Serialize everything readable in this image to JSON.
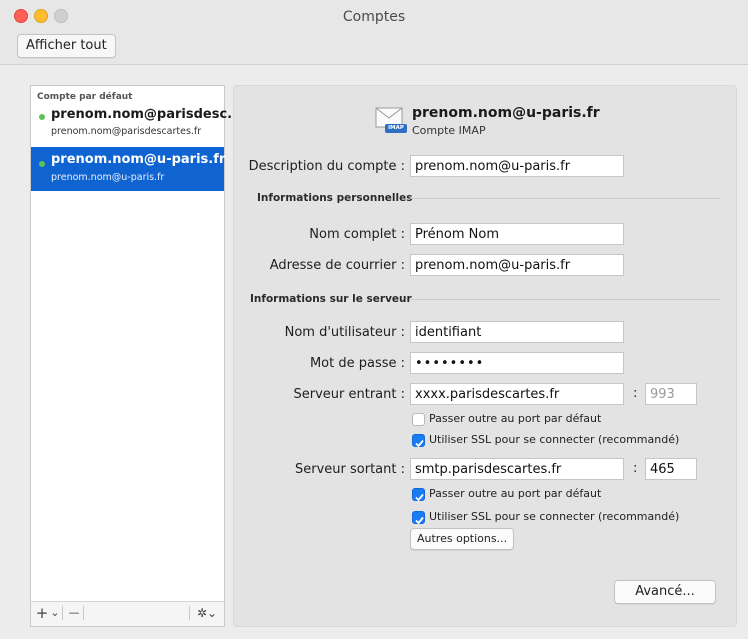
{
  "window": {
    "title": "Comptes",
    "show_all_label": "Afficher tout"
  },
  "sidebar": {
    "header": "Compte par défaut",
    "accounts": [
      {
        "title": "prenom.nom@parisdesc...",
        "subtitle": "prenom.nom@parisdescartes.fr",
        "selected": false
      },
      {
        "title": "prenom.nom@u-paris.fr",
        "subtitle": "prenom.nom@u-paris.fr",
        "selected": true
      }
    ],
    "footer": {
      "add": "+",
      "add_menu": "⌄",
      "remove": "—",
      "gear": "✲⌄"
    }
  },
  "account": {
    "email": "prenom.nom@u-paris.fr",
    "type": "Compte IMAP",
    "icon_text": "IMAP"
  },
  "form": {
    "description": {
      "label": "Description du compte :",
      "value": "prenom.nom@u-paris.fr"
    },
    "personal_section": "Informations personnelles",
    "full_name": {
      "label": "Nom complet :",
      "value": "Prénom Nom"
    },
    "email_address": {
      "label": "Adresse de courrier :",
      "value": "prenom.nom@u-paris.fr"
    },
    "server_section": "Informations sur le serveur",
    "username": {
      "label": "Nom d'utilisateur :",
      "value": "identifiant"
    },
    "password": {
      "label": "Mot de passe :",
      "value": "••••••••"
    },
    "incoming": {
      "label": "Serveur entrant :",
      "value": "xxxx.parisdescartes.fr",
      "port": "993",
      "override_port": {
        "label": "Passer outre au port par défaut",
        "checked": false
      },
      "use_ssl": {
        "label": "Utiliser SSL pour se connecter (recommandé)",
        "checked": true
      }
    },
    "outgoing": {
      "label": "Serveur sortant :",
      "value": "smtp.parisdescartes.fr",
      "port": "465",
      "override_port": {
        "label": "Passer outre au port par défaut",
        "checked": true
      },
      "use_ssl": {
        "label": "Utiliser SSL pour se connecter (recommandé)",
        "checked": true
      }
    },
    "more_options_label": "Autres options...",
    "advanced_label": "Avancé..."
  },
  "colors": {
    "selection": "#0f64d2",
    "checkbox": "#1a7cf4",
    "status_dot": "#5ec25a"
  }
}
